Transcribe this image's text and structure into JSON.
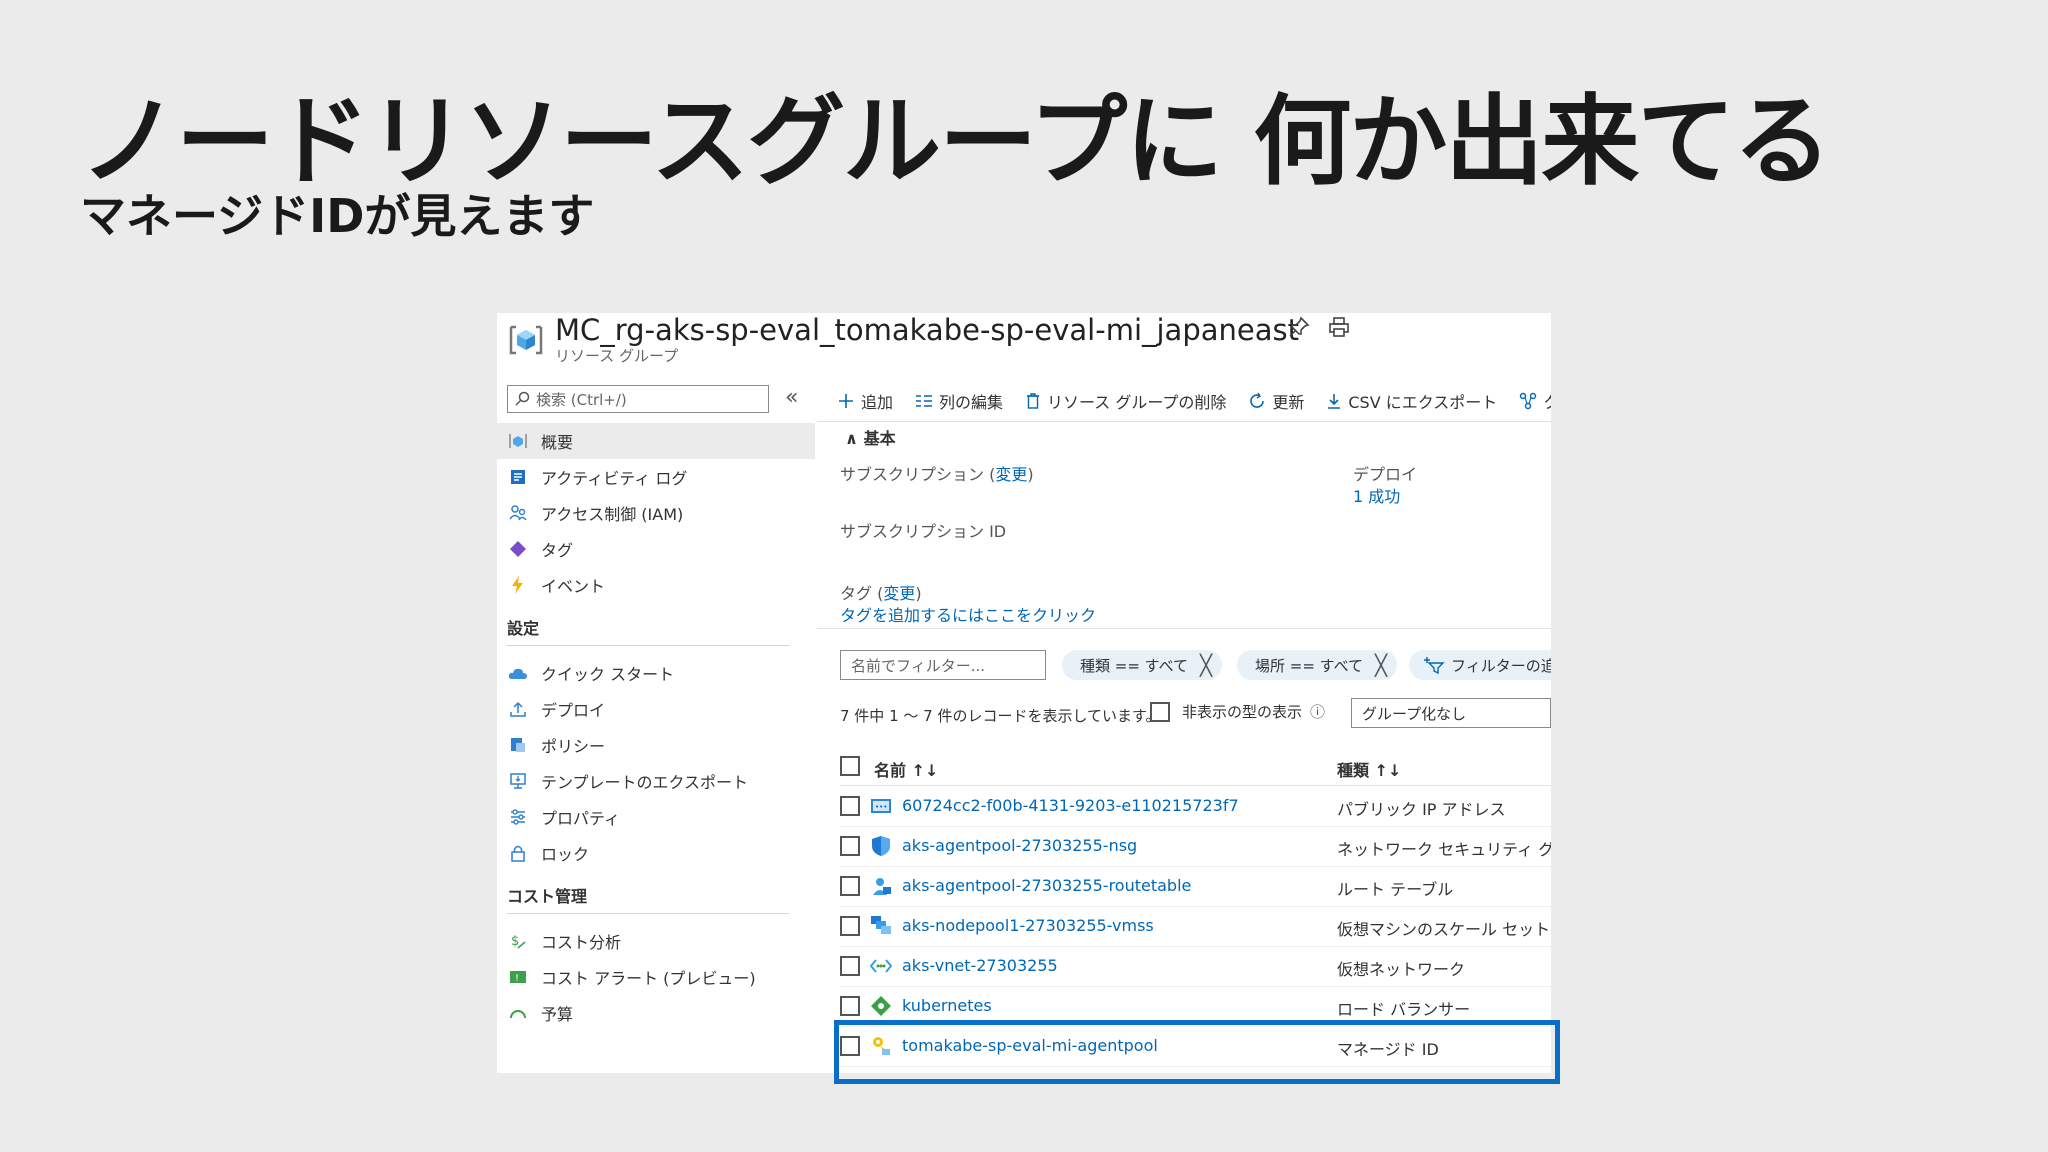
{
  "slide": {
    "title": "ノードリソースグループに 何か出来てる",
    "subtitle": "マネージドIDが見えます"
  },
  "header": {
    "title": "MC_rg-aks-sp-eval_tomakabe-sp-eval-mi_japaneast",
    "subtitle": "リソース グループ"
  },
  "nav": {
    "search_placeholder": "検索 (Ctrl+/)",
    "collapse_glyph": "«",
    "items": [
      {
        "label": "概要"
      },
      {
        "label": "アクティビティ ログ"
      },
      {
        "label": "アクセス制御 (IAM)"
      },
      {
        "label": "タグ"
      },
      {
        "label": "イベント"
      }
    ],
    "settings_header": "設定",
    "settings_items": [
      {
        "label": "クイック スタート"
      },
      {
        "label": "デプロイ"
      },
      {
        "label": "ポリシー"
      },
      {
        "label": "テンプレートのエクスポート"
      },
      {
        "label": "プロパティ"
      },
      {
        "label": "ロック"
      }
    ],
    "cost_header": "コスト管理",
    "cost_items": [
      {
        "label": "コスト分析"
      },
      {
        "label": "コスト アラート (プレビュー)"
      },
      {
        "label": "予算"
      }
    ]
  },
  "toolbar": {
    "add": "追加",
    "edit_columns": "列の編集",
    "delete_rg": "リソース グループの削除",
    "refresh": "更新",
    "export_csv": "CSV にエクスポート",
    "query": "クエ"
  },
  "essentials": {
    "header": "基本",
    "subscription_label": "サブスクリプション (",
    "change": "変更",
    "close_paren": ")",
    "subscription_id_label": "サブスクリプション ID",
    "tags_label": "タグ (",
    "add_tags_link": "タグを追加するにはここをクリック",
    "deployments_label": "デプロイ",
    "deployments_value": "1 成功"
  },
  "filters": {
    "name_placeholder": "名前でフィルター...",
    "type_pill": "種類 == すべて",
    "location_pill": "場所 == すべて",
    "add_filter": "フィルターの追加",
    "close_glyph": "╳"
  },
  "records": {
    "count_text": "7 件中 1 ～ 7 件のレコードを表示しています。",
    "show_hidden": "非表示の型の表示",
    "info_glyph": "ⓘ",
    "grouping": "グループ化なし"
  },
  "table": {
    "col_name": "名前 ↑↓",
    "col_type": "種類 ↑↓",
    "rows": [
      {
        "name": "60724cc2-f00b-4131-9203-e110215723f7",
        "type": "パブリック IP アドレス"
      },
      {
        "name": "aks-agentpool-27303255-nsg",
        "type": "ネットワーク セキュリティ グループ"
      },
      {
        "name": "aks-agentpool-27303255-routetable",
        "type": "ルート テーブル"
      },
      {
        "name": "aks-nodepool1-27303255-vmss",
        "type": "仮想マシンのスケール セット"
      },
      {
        "name": "aks-vnet-27303255",
        "type": "仮想ネットワーク"
      },
      {
        "name": "kubernetes",
        "type": "ロード バランサー"
      },
      {
        "name": "tomakabe-sp-eval-mi-agentpool",
        "type": "マネージド ID"
      }
    ]
  },
  "colors": {
    "link": "#0067b8",
    "highlight": "#0a6ec8",
    "background": "#ebebeb"
  }
}
